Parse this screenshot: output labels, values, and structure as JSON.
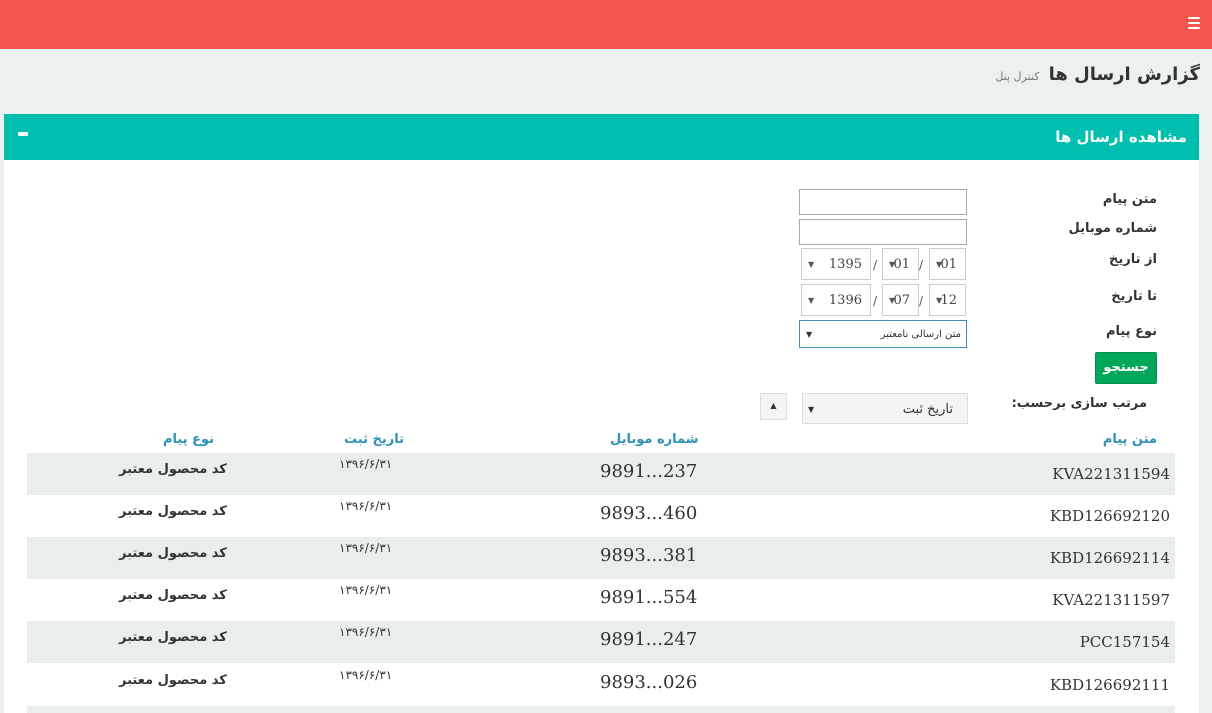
{
  "header": {
    "menu_icon": "hamburger-menu-icon",
    "color": "#f3564e"
  },
  "page": {
    "title": "گزارش ارسال ها",
    "subtitle": "کنترل پنل"
  },
  "box": {
    "title": "مشاهده ارسال ها",
    "accent": "#00bfae"
  },
  "filters": {
    "message_label": "متن پیام",
    "message_value": "",
    "mobile_label": "شماره موبایل",
    "mobile_value": "",
    "from_label": "از تاریخ",
    "from": {
      "year": "1395",
      "month": "01",
      "day": "01"
    },
    "to_label": "تا تاریخ",
    "to": {
      "year": "1396",
      "month": "07",
      "day": "12"
    },
    "type_label": "نوع پیام",
    "type_value": "متن ارسالی نامعتبر",
    "search_label": "جستجو",
    "separator": "/"
  },
  "sort": {
    "label": "مرتب سازی برحسب:",
    "value": "تاریخ ثبت"
  },
  "table": {
    "headers": {
      "code": "متن پیام",
      "mobile": "شماره موبایل",
      "date": "تاریخ ثبت",
      "type": "نوع پیام"
    },
    "rows": [
      {
        "code": "KVA221311594",
        "mobile": "9891...237",
        "date": "۱۳۹۶/۶/۳۱",
        "type": "کد محصول معتبر"
      },
      {
        "code": "KBD126692120",
        "mobile": "9893...460",
        "date": "۱۳۹۶/۶/۳۱",
        "type": "کد محصول معتبر"
      },
      {
        "code": "KBD126692114",
        "mobile": "9893...381",
        "date": "۱۳۹۶/۶/۳۱",
        "type": "کد محصول معتبر"
      },
      {
        "code": "KVA221311597",
        "mobile": "9891...554",
        "date": "۱۳۹۶/۶/۳۱",
        "type": "کد محصول معتبر"
      },
      {
        "code": "PCC157154",
        "mobile": "9891...247",
        "date": "۱۳۹۶/۶/۳۱",
        "type": "کد محصول معتبر"
      },
      {
        "code": "KBD126692111",
        "mobile": "9893...026",
        "date": "۱۳۹۶/۶/۳۱",
        "type": "کد محصول معتبر"
      }
    ]
  }
}
